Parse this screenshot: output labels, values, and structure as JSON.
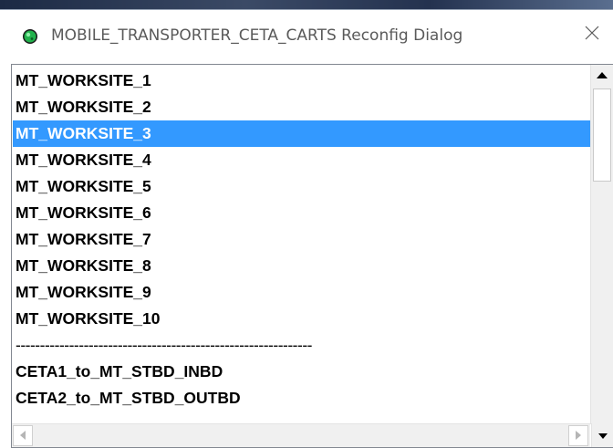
{
  "window": {
    "title": "MOBILE_TRANSPORTER_CETA_CARTS Reconfig Dialog",
    "close_glyph": "✕",
    "icon": "green-ball-app-icon"
  },
  "colors": {
    "selection": "#3399ff",
    "title_text": "#5a5a5a",
    "list_text": "#000000"
  },
  "list": {
    "selected_index": 2,
    "items": [
      "MT_WORKSITE_1",
      "MT_WORKSITE_2",
      "MT_WORKSITE_3",
      "MT_WORKSITE_4",
      "MT_WORKSITE_5",
      "MT_WORKSITE_6",
      "MT_WORKSITE_7",
      "MT_WORKSITE_8",
      "MT_WORKSITE_9",
      "MT_WORKSITE_10",
      "-------------------------------------------------------------",
      "CETA1_to_MT_STBD_INBD",
      "CETA2_to_MT_STBD_OUTBD"
    ]
  },
  "scrollbars": {
    "up_icon": "triangle-up-icon",
    "down_icon": "triangle-down-icon",
    "left_icon": "triangle-left-icon",
    "right_icon": "triangle-right-icon"
  }
}
